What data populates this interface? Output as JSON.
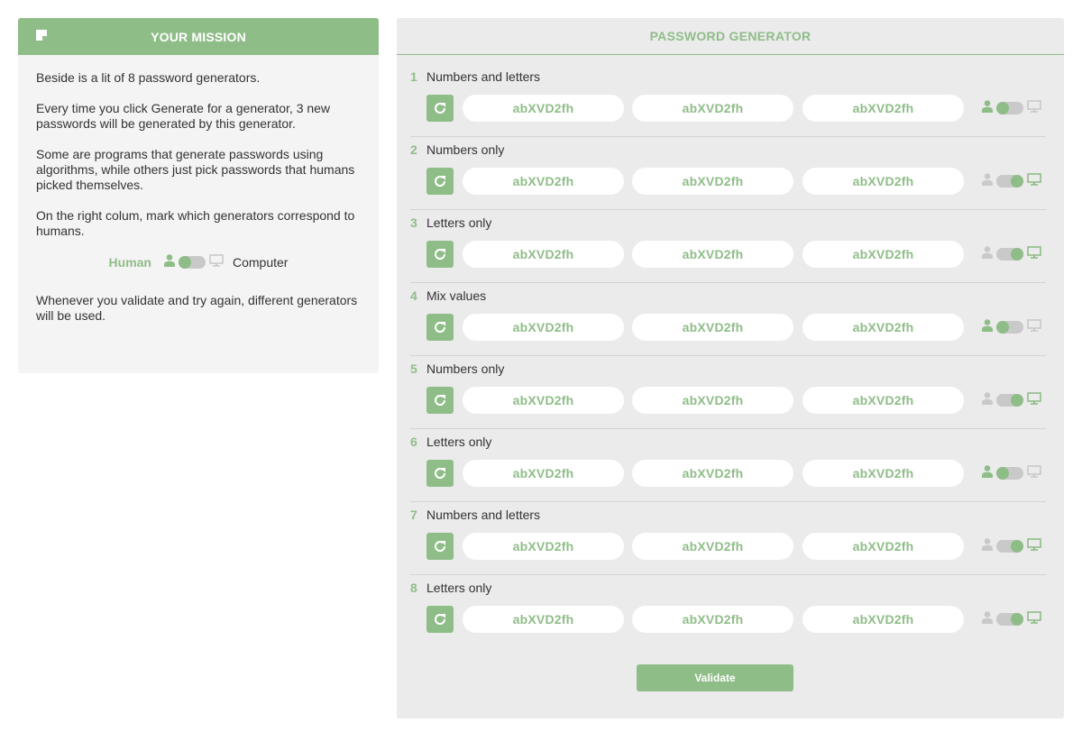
{
  "mission": {
    "title": "YOUR MISSION",
    "paragraphs": [
      "Beside is a lit of 8 password generators.",
      "Every time you click Generate for a generator, 3 new passwords will be generated by this generator.",
      "Some are programs that generate passwords using algorithms, while others just pick passwords that humans picked themselves.",
      "On the right colum, mark which generators correspond to humans."
    ],
    "legend": {
      "human_label": "Human",
      "computer_label": "Computer"
    },
    "footer": "Whenever you validate and try again, different generators will be used."
  },
  "generator": {
    "title": "PASSWORD GENERATOR",
    "rows": [
      {
        "num": "1",
        "title": "Numbers and letters",
        "passwords": [
          "abXVD2fh",
          "abXVD2fh",
          "abXVD2fh"
        ],
        "selection": "human"
      },
      {
        "num": "2",
        "title": "Numbers only",
        "passwords": [
          "abXVD2fh",
          "abXVD2fh",
          "abXVD2fh"
        ],
        "selection": "computer"
      },
      {
        "num": "3",
        "title": "Letters only",
        "passwords": [
          "abXVD2fh",
          "abXVD2fh",
          "abXVD2fh"
        ],
        "selection": "computer"
      },
      {
        "num": "4",
        "title": "Mix values",
        "passwords": [
          "abXVD2fh",
          "abXVD2fh",
          "abXVD2fh"
        ],
        "selection": "human"
      },
      {
        "num": "5",
        "title": "Numbers only",
        "passwords": [
          "abXVD2fh",
          "abXVD2fh",
          "abXVD2fh"
        ],
        "selection": "computer"
      },
      {
        "num": "6",
        "title": "Letters only",
        "passwords": [
          "abXVD2fh",
          "abXVD2fh",
          "abXVD2fh"
        ],
        "selection": "human"
      },
      {
        "num": "7",
        "title": "Numbers and letters",
        "passwords": [
          "abXVD2fh",
          "abXVD2fh",
          "abXVD2fh"
        ],
        "selection": "computer"
      },
      {
        "num": "8",
        "title": "Letters only",
        "passwords": [
          "abXVD2fh",
          "abXVD2fh",
          "abXVD2fh"
        ],
        "selection": "computer"
      }
    ],
    "validate_label": "Validate"
  },
  "icons": {
    "mission_header": "note-icon",
    "regenerate": "refresh-icon",
    "human": "person-icon",
    "computer": "monitor-icon"
  },
  "colors": {
    "accent": "#8fbd88",
    "inactive_icon": "#c9c9c9",
    "panel_bg": "#f4f4f4",
    "generator_bg": "#ebebeb"
  }
}
